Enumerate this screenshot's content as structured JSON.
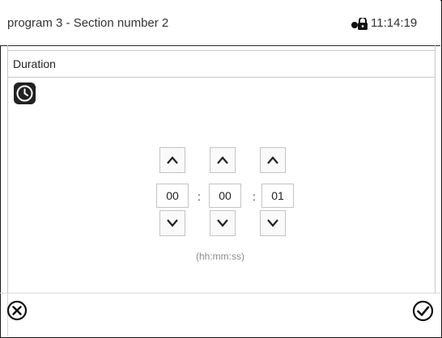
{
  "header": {
    "title": "program 3 - Section number 2",
    "time": "11:14:19",
    "lock_icon": "lock-key-icon"
  },
  "dialog": {
    "title": "Duration",
    "icon": "timer-icon"
  },
  "time_picker": {
    "hours": "00",
    "minutes": "00",
    "seconds": "01",
    "separator": ":",
    "format_hint": "(hh:mm:ss)",
    "increment_icon": "chevron-up-icon",
    "decrement_icon": "chevron-down-icon"
  },
  "footer": {
    "cancel_icon": "cancel-circle-icon",
    "confirm_icon": "confirm-check-circle-icon"
  }
}
